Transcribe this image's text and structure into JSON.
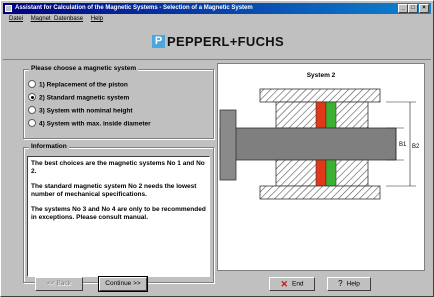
{
  "window": {
    "title": "Assistant for Calculation of the Magnetic Systems - Selection of a Magnetic System",
    "controls": [
      "_",
      "□",
      "×"
    ]
  },
  "menu": [
    "Datei",
    "Magnet_Datenbase",
    "Help"
  ],
  "brand": {
    "mark": "P",
    "name": "PEPPERL+FUCHS",
    "mark_color": "#4da6e0"
  },
  "choice": {
    "legend": "Please choose a magnetic system",
    "options": [
      {
        "label": "1) Replacement of the piston",
        "selected": false
      },
      {
        "label": "2) Standard magnetic system",
        "selected": true
      },
      {
        "label": "3) System with nominal height",
        "selected": false
      },
      {
        "label": "4) System with max. inside diameter",
        "selected": false
      }
    ]
  },
  "information": {
    "legend": "Information",
    "paragraphs": [
      "The best choices are the magnetic systems No 1 and No 2.",
      "The standard magnetic system No 2 needs the lowest number of mechanical specifications.",
      "The systems No 3 and No 4 are only to be recommended in exceptions. Please consult manual."
    ]
  },
  "diagram": {
    "title": "System 2",
    "dim_labels": [
      "B1",
      "B2"
    ],
    "magnet_colors": {
      "red": "#e03818",
      "green": "#3cb030"
    }
  },
  "buttons": {
    "back": "<< Back",
    "continue": "Continue >>",
    "end": "End",
    "help": "Help"
  }
}
